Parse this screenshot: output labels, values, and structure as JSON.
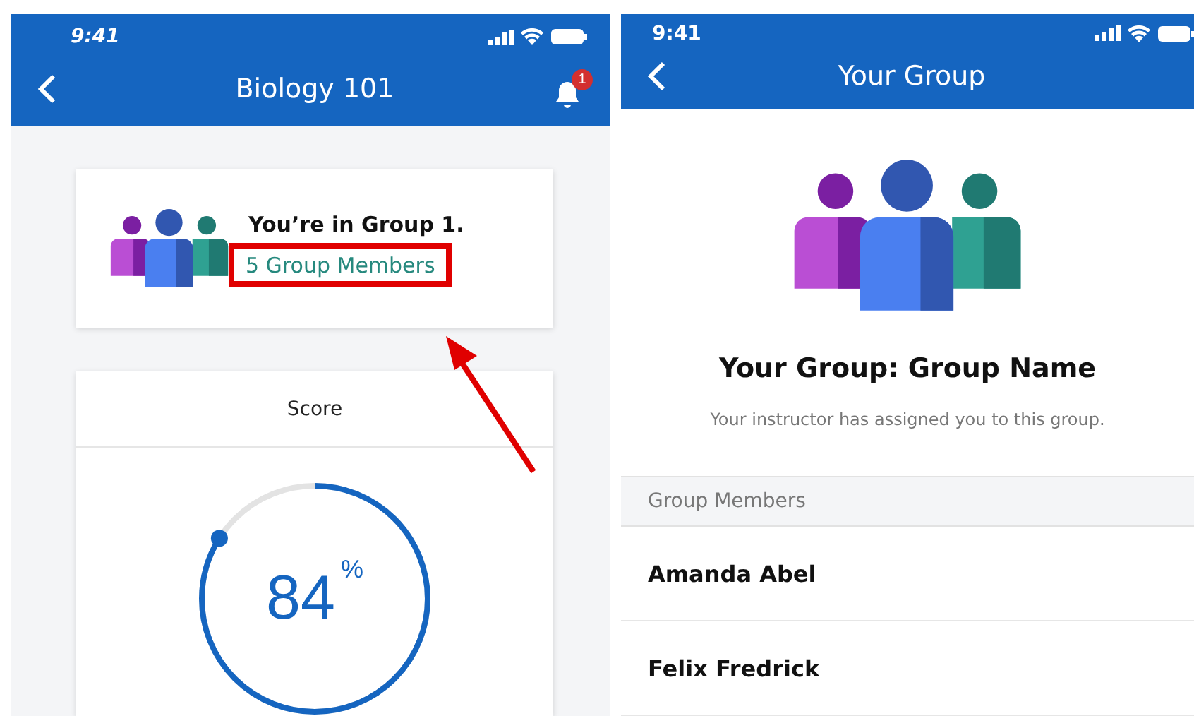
{
  "left_screen": {
    "status_bar": {
      "time": "9:41"
    },
    "nav": {
      "title": "Biology 101",
      "notification_count": "1"
    },
    "group_card": {
      "heading": "You’re in Group 1.",
      "link": "5 Group Members"
    },
    "score_card": {
      "title": "Score",
      "value": "84",
      "unit": "%",
      "level": 0.84
    }
  },
  "right_screen": {
    "status_bar": {
      "time": "9:41"
    },
    "nav": {
      "title": "Your Group"
    },
    "heading": "Your Group: Group Name",
    "subtitle": "Your instructor has assigned you to this group.",
    "section_title": "Group Members",
    "members": [
      {
        "name": "Amanda Abel"
      },
      {
        "name": "Felix Fredrick"
      }
    ]
  }
}
